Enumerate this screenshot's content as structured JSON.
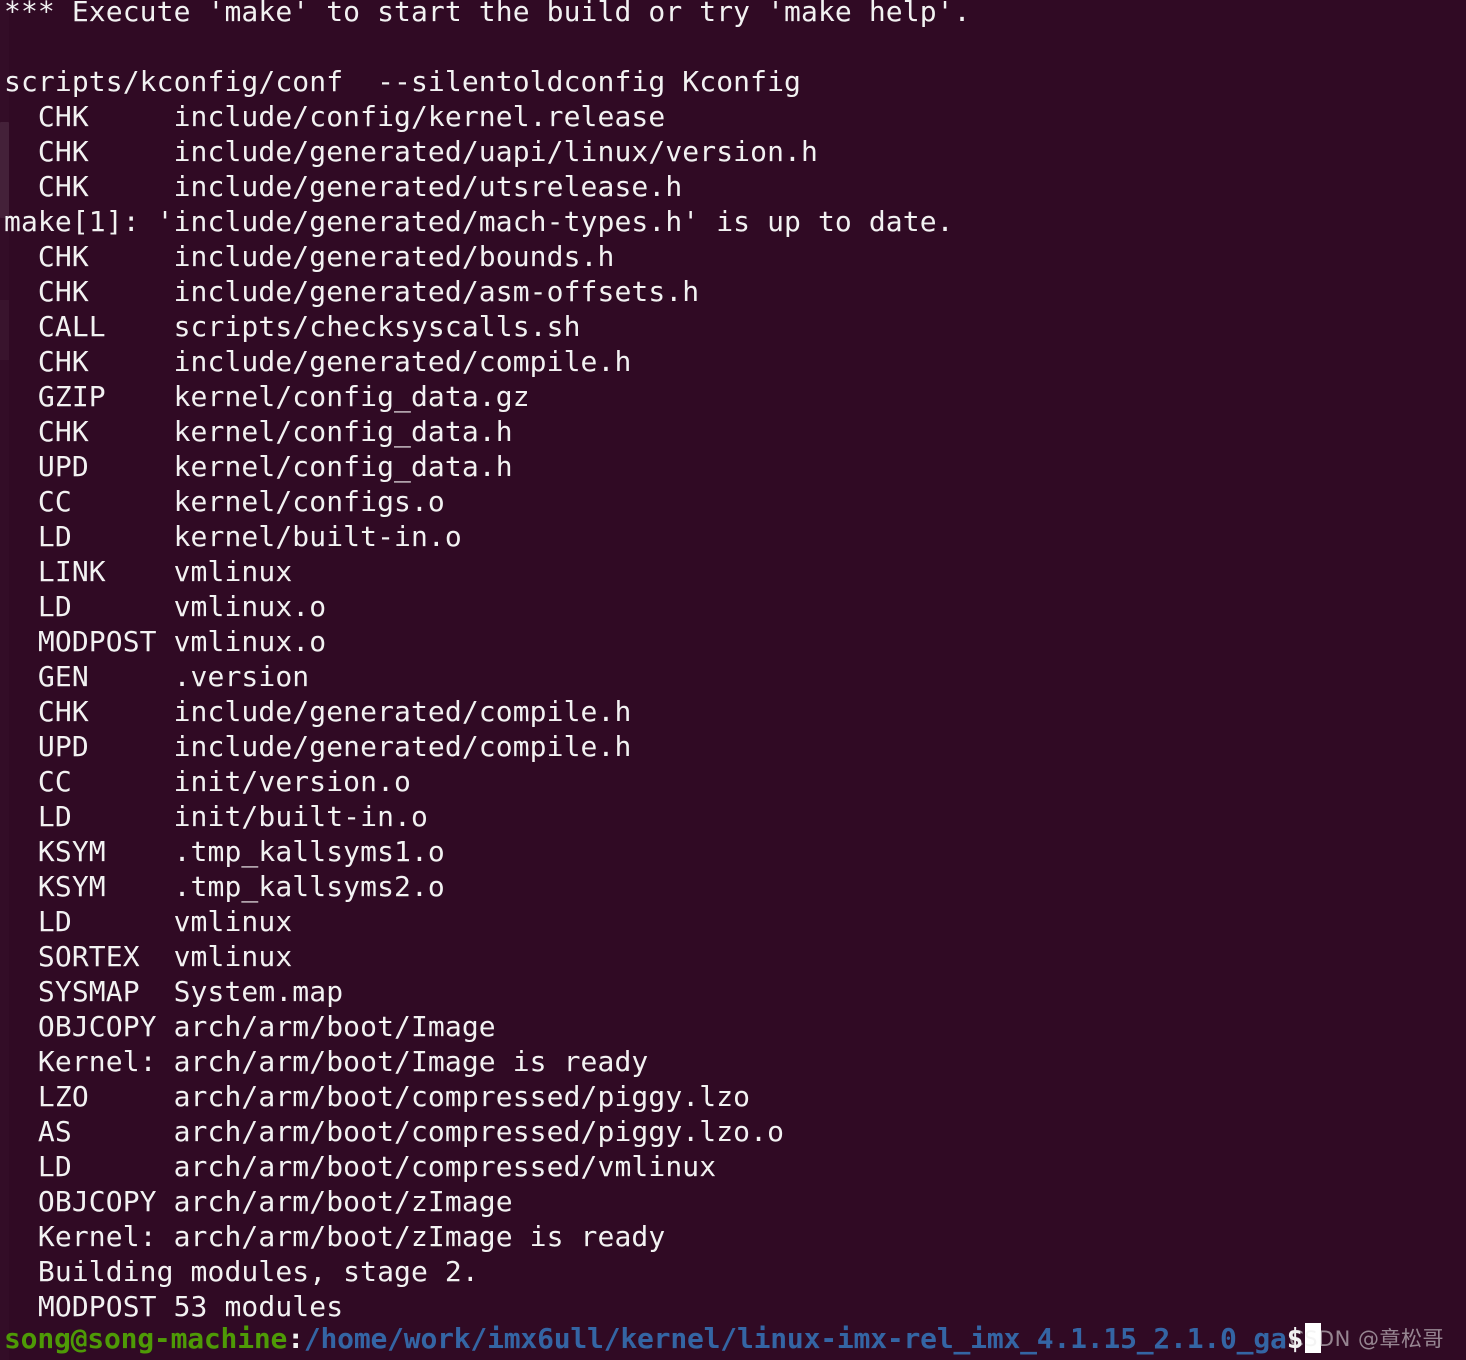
{
  "terminal": {
    "background_color": "#300a24",
    "foreground_color": "#f2f2f2",
    "scrollback_lines": [
      "*** Execute 'make' to start the build or try 'make help'.",
      "",
      "scripts/kconfig/conf  --silentoldconfig Kconfig",
      "  CHK     include/config/kernel.release",
      "  CHK     include/generated/uapi/linux/version.h",
      "  CHK     include/generated/utsrelease.h",
      "make[1]: 'include/generated/mach-types.h' is up to date.",
      "  CHK     include/generated/bounds.h",
      "  CHK     include/generated/asm-offsets.h",
      "  CALL    scripts/checksyscalls.sh",
      "  CHK     include/generated/compile.h",
      "  GZIP    kernel/config_data.gz",
      "  CHK     kernel/config_data.h",
      "  UPD     kernel/config_data.h",
      "  CC      kernel/configs.o",
      "  LD      kernel/built-in.o",
      "  LINK    vmlinux",
      "  LD      vmlinux.o",
      "  MODPOST vmlinux.o",
      "  GEN     .version",
      "  CHK     include/generated/compile.h",
      "  UPD     include/generated/compile.h",
      "  CC      init/version.o",
      "  LD      init/built-in.o",
      "  KSYM    .tmp_kallsyms1.o",
      "  KSYM    .tmp_kallsyms2.o",
      "  LD      vmlinux",
      "  SORTEX  vmlinux",
      "  SYSMAP  System.map",
      "  OBJCOPY arch/arm/boot/Image",
      "  Kernel: arch/arm/boot/Image is ready",
      "  LZO     arch/arm/boot/compressed/piggy.lzo",
      "  AS      arch/arm/boot/compressed/piggy.lzo.o",
      "  LD      arch/arm/boot/compressed/vmlinux",
      "  OBJCOPY arch/arm/boot/zImage",
      "  Kernel: arch/arm/boot/zImage is ready",
      "  Building modules, stage 2.",
      "  MODPOST 53 modules"
    ]
  },
  "prompt": {
    "user_host": "song@song-machine",
    "separator": ":",
    "path": "/home/work/imx6ull/kernel/linux-imx-rel_imx_4.1.15_2.1.0_ga",
    "symbol": "$",
    "command": "",
    "user_color": "#4e9a06",
    "path_color": "#3465a4",
    "cursor_color": "#ffffff"
  },
  "watermark": {
    "text": "CSDN @章松哥"
  },
  "scrollbar": {
    "name": "vertical-scrollbar"
  }
}
